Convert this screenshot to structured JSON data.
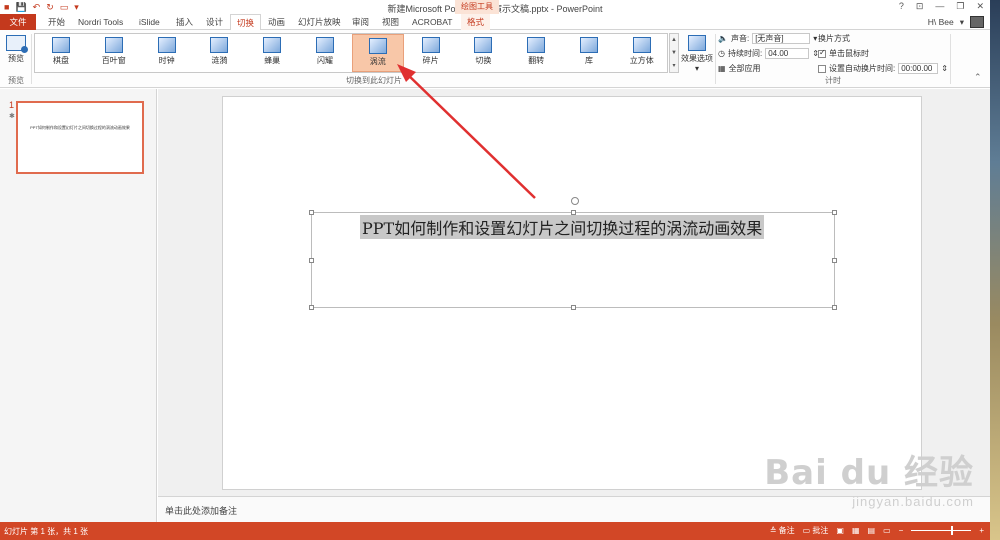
{
  "title_bar": {
    "document_title": "新建Microsoft PowerPoint 演示文稿.pptx - PowerPoint",
    "context_tab": "绘图工具",
    "help": "?",
    "minimize": "—",
    "restore": "❐",
    "close": "✕"
  },
  "tabs": {
    "file": "文件",
    "home": "开始",
    "nordri": "Nordri Tools",
    "islide": "iSlide",
    "insert": "插入",
    "design": "设计",
    "transitions": "切换",
    "animations": "动画",
    "slideshow": "幻灯片放映",
    "review": "审阅",
    "view": "视图",
    "acrobat": "ACROBAT",
    "format": "格式"
  },
  "user": {
    "name": "H\\ Bee"
  },
  "ribbon": {
    "preview": {
      "label": "预览",
      "group_label": "预览"
    },
    "transitions_gallery": {
      "items": [
        {
          "label": "棋盘"
        },
        {
          "label": "百叶窗"
        },
        {
          "label": "时钟"
        },
        {
          "label": "涟漪"
        },
        {
          "label": "蜂巢"
        },
        {
          "label": "闪耀"
        },
        {
          "label": "涡流"
        },
        {
          "label": "碎片"
        },
        {
          "label": "切换"
        },
        {
          "label": "翻转"
        },
        {
          "label": "库"
        },
        {
          "label": "立方体"
        }
      ],
      "selected_index": 6,
      "group_label": "切换到此幻灯片"
    },
    "effect_options": {
      "label": "效果选项"
    },
    "timing": {
      "sound_label": "声音:",
      "sound_value": "[无声音]",
      "duration_label": "持续时间:",
      "duration_value": "04.00",
      "apply_all": "全部应用",
      "advance_title": "换片方式",
      "on_click": "单击鼠标时",
      "on_click_checked": true,
      "auto_after": "设置自动换片时间:",
      "auto_after_value": "00:00.00",
      "auto_after_checked": false,
      "group_label": "计时"
    }
  },
  "slides_pane": {
    "slide_number": "1",
    "thumb_text": "PPT如何制作和设置幻灯片之间切换过程的涡流动画效果"
  },
  "slide": {
    "title": "PPT如何制作和设置幻灯片之间切换过程的涡流动画效果"
  },
  "notes": {
    "placeholder": "单击此处添加备注"
  },
  "status_bar": {
    "slide_info": "幻灯片 第 1 张，共 1 张",
    "notes_btn": "备注",
    "comments_btn": "批注"
  },
  "watermark": {
    "logo": "Bai du 经验",
    "url": "jingyan.baidu.com"
  },
  "colors": {
    "accent": "#c4391d",
    "status_bar": "#d24726",
    "selected_gallery": "#f8c7a8",
    "arrow": "#e03030"
  }
}
